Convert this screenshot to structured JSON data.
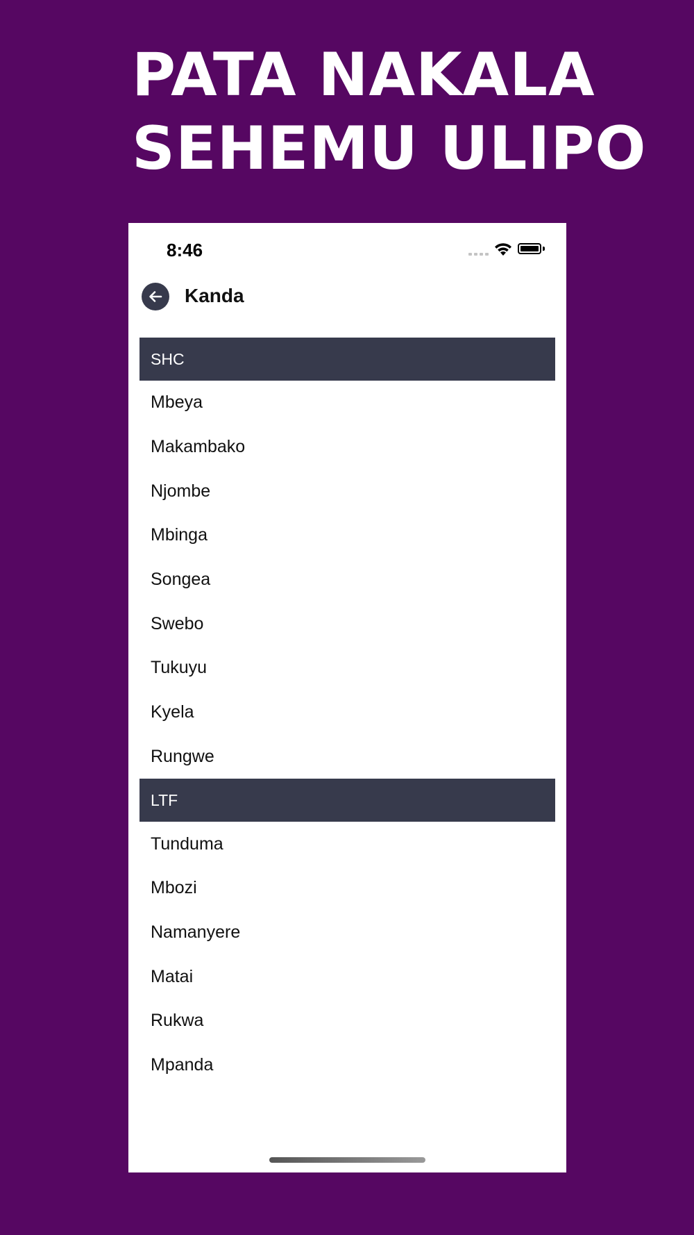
{
  "headline": {
    "line1": "PATA NAKALA",
    "line2": "SEHEMU ULIPO"
  },
  "status_bar": {
    "time": "8:46",
    "icons": [
      "cellular-signal-icon",
      "wifi-icon",
      "battery-icon"
    ]
  },
  "nav": {
    "back_icon": "arrow-left-icon",
    "title": "Kanda"
  },
  "sections": [
    {
      "header": "SHC",
      "items": [
        "Mbeya",
        "Makambako",
        "Njombe",
        "Mbinga",
        "Songea",
        "Swebo",
        "Tukuyu",
        "Kyela",
        "Rungwe"
      ]
    },
    {
      "header": "LTF",
      "items": [
        "Tunduma",
        "Mbozi",
        "Namanyere",
        "Matai",
        "Rukwa",
        "Mpanda"
      ]
    }
  ],
  "colors": {
    "background": "#560762",
    "section_header": "#373a4c",
    "back_button": "#373a4c"
  }
}
